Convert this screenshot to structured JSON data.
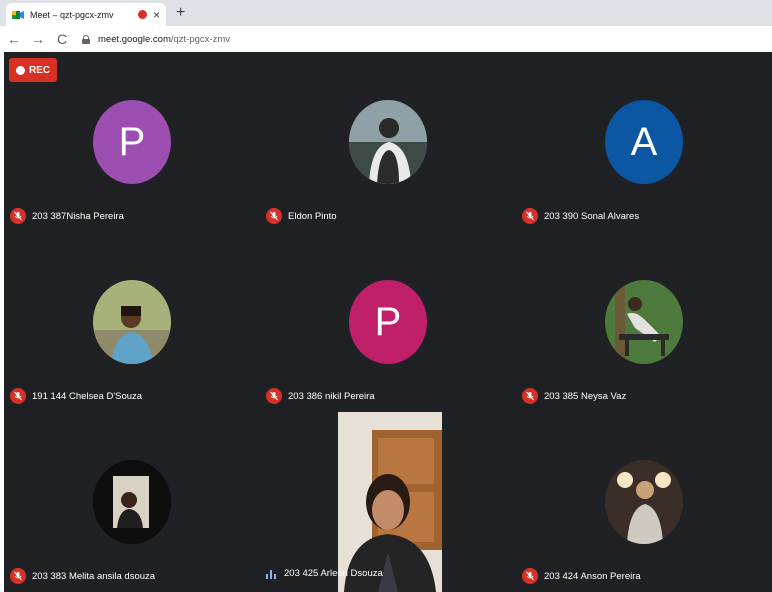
{
  "browser": {
    "tab_title": "Meet – qzt-pgcx-zmv",
    "tab_close": "×",
    "new_tab": "+",
    "url_host": "meet.google.com",
    "url_path": "/qzt-pgcx-zmv",
    "nav": {
      "back": "←",
      "forward": "→",
      "reload": "C"
    }
  },
  "meet": {
    "rec_label": "REC",
    "colors": {
      "background": "#202124",
      "rec": "#d93025",
      "avatar_purple": "#9c4fb0",
      "avatar_pink": "#c0206a",
      "avatar_blue": "#0b57a4"
    },
    "participants": [
      {
        "name": "203 387Nisha Pereira",
        "avatar_letter": "P",
        "muted": true
      },
      {
        "name": "Eldon Pinto",
        "avatar_letter": "",
        "muted": true
      },
      {
        "name": "203 390 Sonal Alvares",
        "avatar_letter": "A",
        "muted": true
      },
      {
        "name": "191 144 Chelsea D'Souza",
        "avatar_letter": "",
        "muted": true
      },
      {
        "name": "203 386 nikil Pereira",
        "avatar_letter": "P",
        "muted": true
      },
      {
        "name": "203 385 Neysa Vaz",
        "avatar_letter": "",
        "muted": true
      },
      {
        "name": "203 383 Melita ansila dsouza",
        "avatar_letter": "",
        "muted": true
      },
      {
        "name": "203 425 Arleen Dsouza",
        "avatar_letter": "",
        "muted": false
      },
      {
        "name": "203 424 Anson Pereira",
        "avatar_letter": "",
        "muted": true
      }
    ]
  }
}
